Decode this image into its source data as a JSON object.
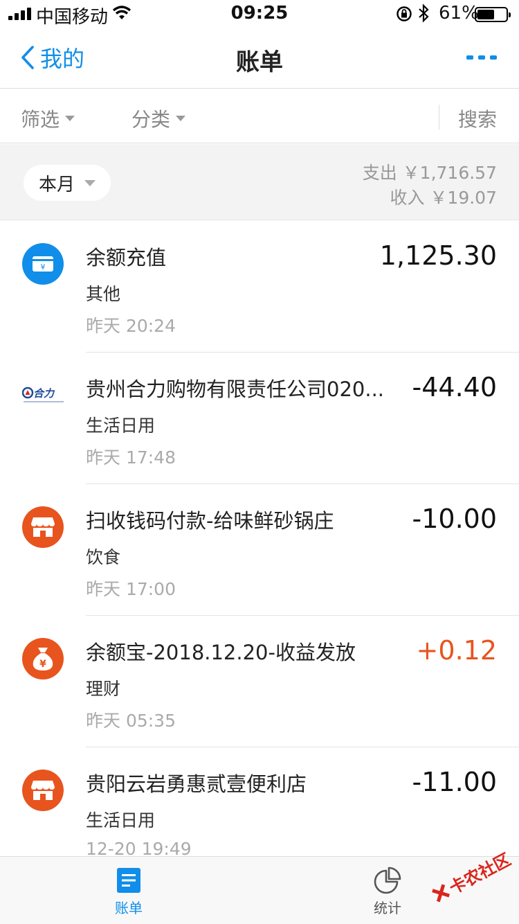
{
  "status_bar": {
    "carrier": "中国移动",
    "time": "09:25",
    "battery_pct": "61%",
    "battery_level": 0.61
  },
  "nav": {
    "back_label": "我的",
    "title": "账单",
    "more_icon": "more-dots-icon"
  },
  "filter_bar": {
    "filter_label": "筛选",
    "category_label": "分类",
    "search_label": "搜索"
  },
  "summary": {
    "period": "本月",
    "expense": "支出 ￥1,716.57",
    "income": "收入 ￥19.07"
  },
  "colors": {
    "accent": "#108ee9",
    "orange": "#e8541e",
    "income": "#e8541e"
  },
  "transactions": [
    {
      "icon": "balance-topup-icon",
      "title": "余额充值",
      "category": "其他",
      "time": "昨天  20:24",
      "amount": "1,125.30"
    },
    {
      "icon": "heli-logo",
      "logo_text": "合力",
      "title": "贵州合力购物有限责任公司020...",
      "category": "生活日用",
      "time": "昨天  17:48",
      "amount": "-44.40"
    },
    {
      "icon": "store-icon",
      "title": "扫收钱码付款-给味鲜砂锅庄",
      "category": "饮食",
      "time": "昨天  17:00",
      "amount": "-10.00"
    },
    {
      "icon": "money-bag-icon",
      "title": "余额宝-2018.12.20-收益发放",
      "category": "理财",
      "time": "昨天  05:35",
      "amount": "+0.12"
    },
    {
      "icon": "store-icon",
      "title": "贵阳云岩勇惠贰壹便利店",
      "category": "生活日用",
      "time": "12-20  19:49",
      "amount": "-11.00"
    }
  ],
  "tab_bar": {
    "bill_label": "账单",
    "stats_label": "统计"
  },
  "watermark": {
    "text": "卡农社区"
  }
}
